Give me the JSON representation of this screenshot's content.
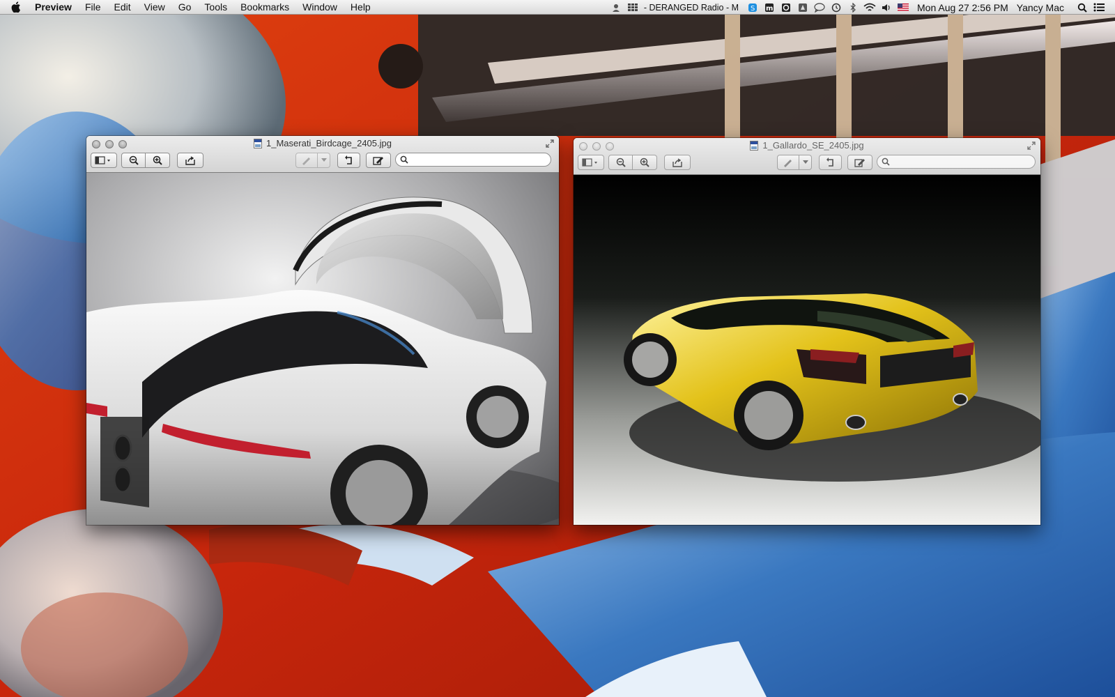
{
  "menubar": {
    "apple_icon": "apple-icon",
    "items": [
      "Preview",
      "File",
      "Edit",
      "View",
      "Go",
      "Tools",
      "Bookmarks",
      "Window",
      "Help"
    ],
    "now_playing": "- DERANGED Radio - M",
    "clock": "Mon Aug 27  2:56 PM",
    "user": "Yancy Mac",
    "status_icons": [
      "person-icon",
      "grid-icon",
      "skype-icon",
      "m-icon",
      "box-icon",
      "app-icon",
      "chat-icon",
      "time-machine-icon",
      "bluetooth-icon",
      "wifi-icon",
      "volume-icon",
      "flag-icon",
      "spotlight-icon",
      "list-icon"
    ]
  },
  "windows": [
    {
      "title": "1_Maserati_Birdcage_2405.jpg",
      "active": true,
      "toolbar": [
        "sidebar-view-icon",
        "zoom-out-icon",
        "zoom-in-icon",
        "share-icon",
        "annotate-icon",
        "rotate-icon",
        "edit-icon",
        "search-icon"
      ],
      "search_placeholder": ""
    },
    {
      "title": "1_Gallardo_SE_2405.jpg",
      "active": false,
      "toolbar": [
        "sidebar-view-icon",
        "zoom-out-icon",
        "zoom-in-icon",
        "share-icon",
        "annotate-icon",
        "rotate-icon",
        "edit-icon",
        "search-icon"
      ],
      "search_placeholder": ""
    }
  ],
  "colors": {
    "wallpaper_red": "#c8260c",
    "wallpaper_blue": "#3a78c0",
    "maserati_white": "#d9d9d9",
    "gallardo_yellow": "#e3c21a"
  }
}
